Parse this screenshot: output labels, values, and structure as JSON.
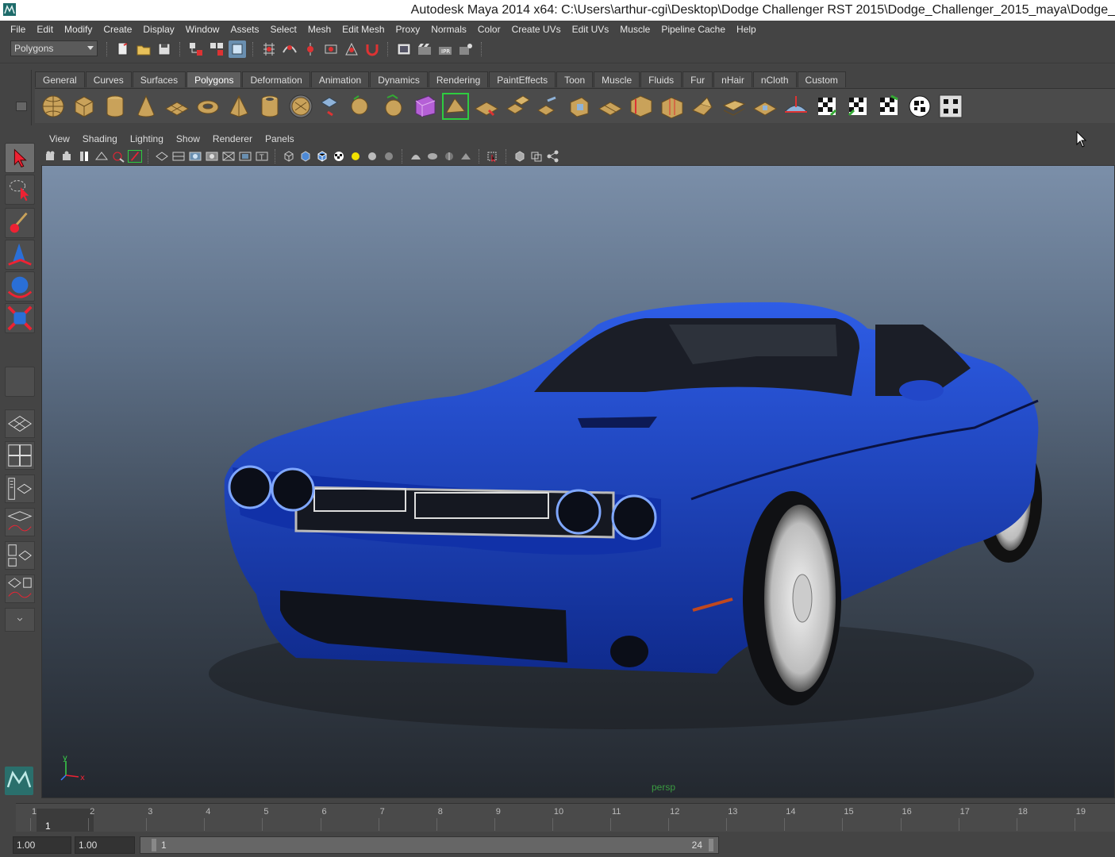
{
  "window": {
    "title": "Autodesk Maya 2014 x64: C:\\Users\\arthur-cgi\\Desktop\\Dodge Challenger RST 2015\\Dodge_Challenger_2015_maya\\Dodge_"
  },
  "menubar": {
    "items": [
      "File",
      "Edit",
      "Modify",
      "Create",
      "Display",
      "Window",
      "Assets",
      "Select",
      "Mesh",
      "Edit Mesh",
      "Proxy",
      "Normals",
      "Color",
      "Create UVs",
      "Edit UVs",
      "Muscle",
      "Pipeline Cache",
      "Help"
    ]
  },
  "statusline": {
    "mode": "Polygons"
  },
  "shelf": {
    "tabs": [
      "General",
      "Curves",
      "Surfaces",
      "Polygons",
      "Deformation",
      "Animation",
      "Dynamics",
      "Rendering",
      "PaintEffects",
      "Toon",
      "Muscle",
      "Fluids",
      "Fur",
      "nHair",
      "nCloth",
      "Custom"
    ],
    "active_tab": "Polygons"
  },
  "panel": {
    "menus": [
      "View",
      "Shading",
      "Lighting",
      "Show",
      "Renderer",
      "Panels"
    ],
    "camera": "persp",
    "axis_x": "x",
    "axis_y": "y"
  },
  "timeslider": {
    "ticks": [
      "1",
      "2",
      "3",
      "4",
      "5",
      "6",
      "7",
      "8",
      "9",
      "10",
      "11",
      "12",
      "13",
      "14",
      "15",
      "16",
      "17",
      "18",
      "19"
    ],
    "current_frame": "1"
  },
  "rangeslider": {
    "start_time": "1.00",
    "playback_start": "1.00",
    "range_start": "1",
    "range_end": "24"
  },
  "colors": {
    "car_body": "#1a3fc0",
    "viewport_top": "#7b8fa9",
    "viewport_bottom": "#23282f"
  }
}
